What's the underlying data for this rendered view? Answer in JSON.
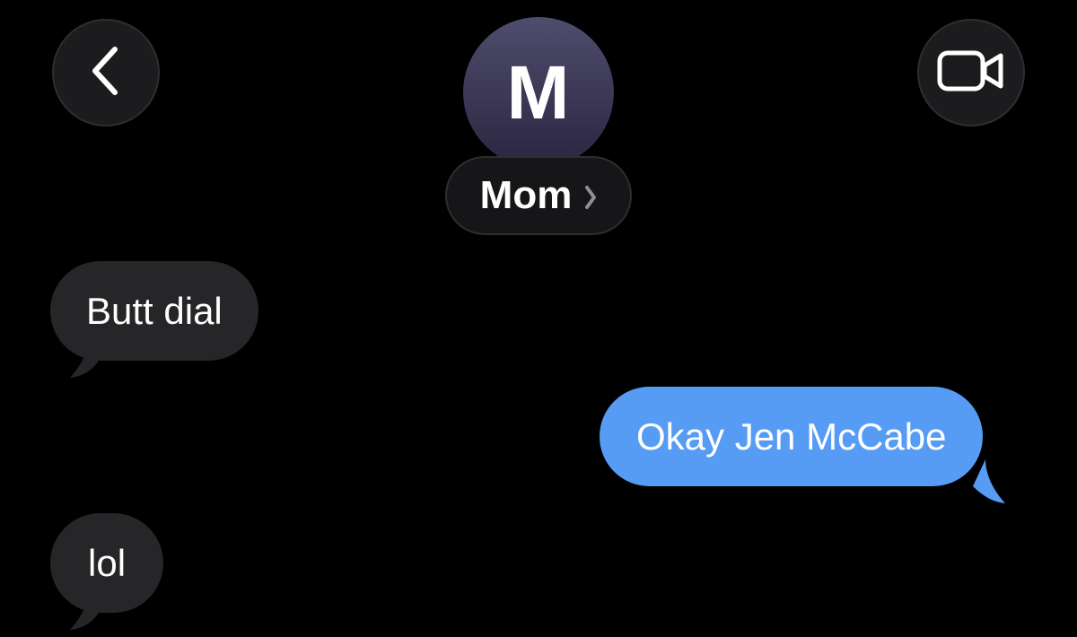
{
  "header": {
    "back_icon": "chevron-left-icon",
    "video_icon": "video-camera-icon",
    "contact": {
      "initial": "M",
      "name": "Mom",
      "chevron_icon": "chevron-right-icon"
    }
  },
  "messages": [
    {
      "direction": "incoming",
      "text": "Butt dial"
    },
    {
      "direction": "outgoing",
      "text": "Okay Jen McCabe"
    },
    {
      "direction": "incoming",
      "text": "lol"
    }
  ],
  "colors": {
    "background": "#000000",
    "incoming_bubble": "#262629",
    "outgoing_bubble": "#579cf4",
    "button_bg": "#1c1c1e",
    "avatar_top": "#4f4d6d",
    "avatar_bottom": "#2a2540"
  }
}
